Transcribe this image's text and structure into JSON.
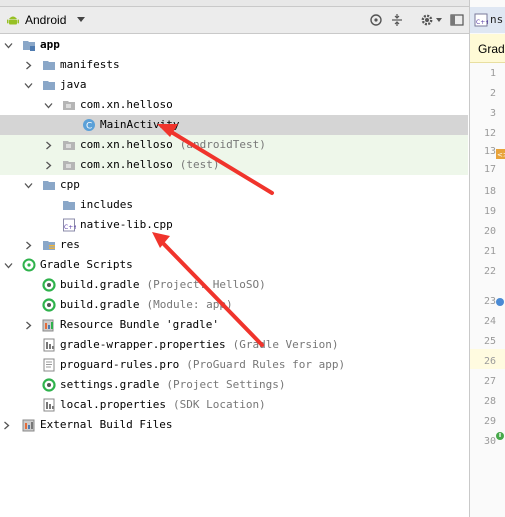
{
  "toolbar": {
    "view_selector": "Android"
  },
  "tree": [
    {
      "id": "app",
      "depth": 0,
      "expanded": true,
      "icon": "module-folder-icon",
      "label": "app",
      "bold": true,
      "hint": ""
    },
    {
      "id": "manifests",
      "depth": 1,
      "expanded": false,
      "icon": "folder-icon",
      "label": "manifests",
      "hint": ""
    },
    {
      "id": "java",
      "depth": 1,
      "expanded": true,
      "icon": "folder-icon",
      "label": "java",
      "hint": ""
    },
    {
      "id": "pkg-main",
      "depth": 2,
      "expanded": true,
      "icon": "package-icon",
      "label": "com.xn.helloso",
      "hint": ""
    },
    {
      "id": "main-activity",
      "depth": 3,
      "leaf": true,
      "icon": "class-icon",
      "label": "MainActivity",
      "hint": "",
      "selected": true
    },
    {
      "id": "pkg-android-test",
      "depth": 2,
      "expanded": false,
      "icon": "package-icon",
      "label": "com.xn.helloso",
      "hint": "(androidTest)",
      "green": true
    },
    {
      "id": "pkg-test",
      "depth": 2,
      "expanded": false,
      "icon": "package-icon",
      "label": "com.xn.helloso",
      "hint": "(test)",
      "green": true
    },
    {
      "id": "cpp",
      "depth": 1,
      "expanded": true,
      "icon": "folder-icon",
      "label": "cpp",
      "hint": ""
    },
    {
      "id": "includes",
      "depth": 2,
      "leaf": true,
      "icon": "folder-icon",
      "label": "includes",
      "hint": ""
    },
    {
      "id": "native-lib",
      "depth": 2,
      "leaf": true,
      "icon": "cpp-file-icon",
      "label": "native-lib.cpp",
      "hint": ""
    },
    {
      "id": "res",
      "depth": 1,
      "expanded": false,
      "icon": "res-folder-icon",
      "label": "res",
      "hint": ""
    },
    {
      "id": "gradle-scripts",
      "depth": 0,
      "expanded": true,
      "icon": "gradle-icon",
      "label": "Gradle Scripts",
      "hint": ""
    },
    {
      "id": "build-gradle-project",
      "depth": 1,
      "leaf": true,
      "icon": "gradle-file-icon",
      "label": "build.gradle",
      "hint": "(Project: HelloSO)"
    },
    {
      "id": "build-gradle-module",
      "depth": 1,
      "leaf": true,
      "icon": "gradle-file-icon",
      "label": "build.gradle",
      "hint": "(Module: app)"
    },
    {
      "id": "resource-bundle",
      "depth": 1,
      "expanded": false,
      "icon": "resource-bundle-icon",
      "label": "Resource Bundle 'gradle'",
      "hint": ""
    },
    {
      "id": "gradle-wrapper",
      "depth": 1,
      "leaf": true,
      "icon": "properties-file-icon",
      "label": "gradle-wrapper.properties",
      "hint": "(Gradle Version)"
    },
    {
      "id": "proguard",
      "depth": 1,
      "leaf": true,
      "icon": "text-file-icon",
      "label": "proguard-rules.pro",
      "hint": "(ProGuard Rules for app)"
    },
    {
      "id": "settings-gradle",
      "depth": 1,
      "leaf": true,
      "icon": "gradle-file-icon",
      "label": "settings.gradle",
      "hint": "(Project Settings)"
    },
    {
      "id": "local-properties",
      "depth": 1,
      "leaf": true,
      "icon": "properties-file-icon",
      "label": "local.properties",
      "hint": "(SDK Location)"
    },
    {
      "id": "external-build",
      "depth": -1,
      "expanded": false,
      "icon": "external-build-icon",
      "label": "External Build Files",
      "hint": ""
    }
  ],
  "editor": {
    "tab_label": "ns",
    "banner_text": "Grad",
    "line_numbers": [
      "1",
      "2",
      "3",
      "12",
      "13",
      "17",
      "18",
      "19",
      "20",
      "21",
      "22",
      "23",
      "24",
      "25",
      "26",
      "27",
      "28",
      "29",
      "30"
    ]
  },
  "colors": {
    "selection": "#d5d5d5",
    "test_source": "#eef7ea",
    "annotation_arrow": "#f0342c",
    "folder": "#8aa7c8",
    "gradle": "#2fb24c"
  }
}
